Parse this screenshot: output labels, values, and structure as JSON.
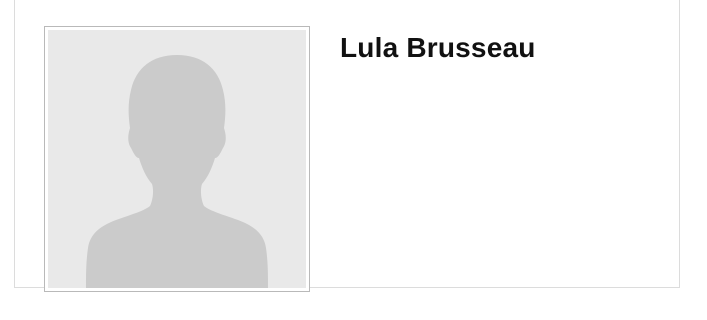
{
  "profile": {
    "name": "Lula Brusseau",
    "avatar_icon": "default-person-silhouette-icon"
  },
  "colors": {
    "card_border": "#dcdcdc",
    "avatar_border": "#b9b9b9",
    "avatar_bg": "#e9e9e9",
    "silhouette": "#c9c9c9",
    "name_text": "#111111"
  }
}
